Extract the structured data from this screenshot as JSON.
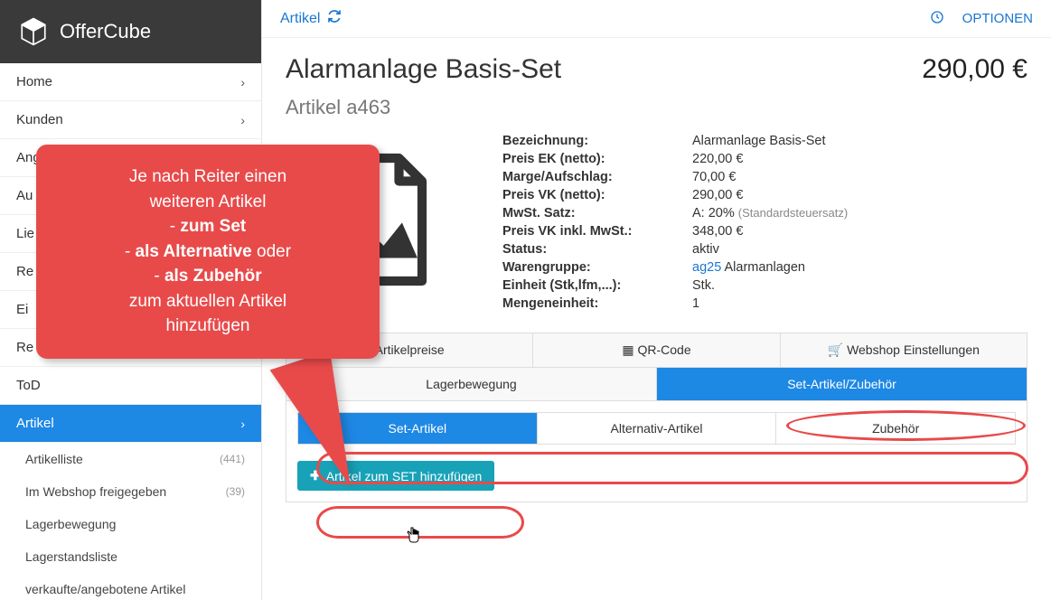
{
  "brand": "OfferCube",
  "topbar": {
    "breadcrumb": "Artikel",
    "options": "OPTIONEN"
  },
  "sidebar": {
    "items": [
      {
        "label": "Home"
      },
      {
        "label": "Kunden"
      },
      {
        "label": "Angebote"
      },
      {
        "label": "Au"
      },
      {
        "label": "Lie"
      },
      {
        "label": "Re"
      },
      {
        "label": "Ei"
      },
      {
        "label": "Re"
      },
      {
        "label": "ToD"
      }
    ],
    "active": {
      "label": "Artikel"
    },
    "sub": [
      {
        "label": "Artikelliste",
        "count": "(441)"
      },
      {
        "label": "Im Webshop freigegeben",
        "count": "(39)"
      },
      {
        "label": "Lagerbewegung",
        "count": ""
      },
      {
        "label": "Lagerstandsliste",
        "count": ""
      },
      {
        "label": "verkaufte/angebotene Artikel",
        "count": ""
      }
    ]
  },
  "article": {
    "title": "Alarmanlage Basis-Set",
    "price": "290,00 €",
    "subtitle": "Artikel a463",
    "props": {
      "bezeichnung_l": "Bezeichnung:",
      "bezeichnung_v": "Alarmanlage Basis-Set",
      "ek_l": "Preis EK (netto):",
      "ek_v": "220,00 €",
      "marge_l": "Marge/Aufschlag:",
      "marge_v": "70,00 €",
      "vk_l": "Preis VK (netto):",
      "vk_v": "290,00 €",
      "mwst_l": "MwSt. Satz:",
      "mwst_v": "A: 20%",
      "mwst_note": "(Standardsteuersatz)",
      "vkik_l": "Preis VK inkl. MwSt.:",
      "vkik_v": "348,00 €",
      "status_l": "Status:",
      "status_v": "aktiv",
      "wg_l": "Warengruppe:",
      "wg_link": "ag25",
      "wg_rest": " Alarmanlagen",
      "einheit_l": "Einheit (Stk,lfm,...):",
      "einheit_v": "Stk.",
      "menge_l": "Mengeneinheit:",
      "menge_v": "1"
    }
  },
  "tabs1": {
    "t2": "Artikelpreise",
    "t3": "QR-Code",
    "t4": "Webshop Einstellungen"
  },
  "tabs2": {
    "t1": "Lagerbewegung",
    "t2": "Set-Artikel/Zubehör"
  },
  "subtabs": {
    "s1": "Set-Artikel",
    "s2": "Alternativ-Artikel",
    "s3": "Zubehör"
  },
  "add_button": "Artikel zum SET hinzufügen",
  "callout": {
    "l1": "Je nach Reiter einen",
    "l2": "weiteren Artikel",
    "l3a": "- ",
    "l3b": "zum Set",
    "l4a": "- ",
    "l4b": "als Alternative",
    "l4c": " oder",
    "l5a": "- ",
    "l5b": "als Zubehör",
    "l6": "zum aktuellen Artikel",
    "l7": "hinzufügen"
  }
}
